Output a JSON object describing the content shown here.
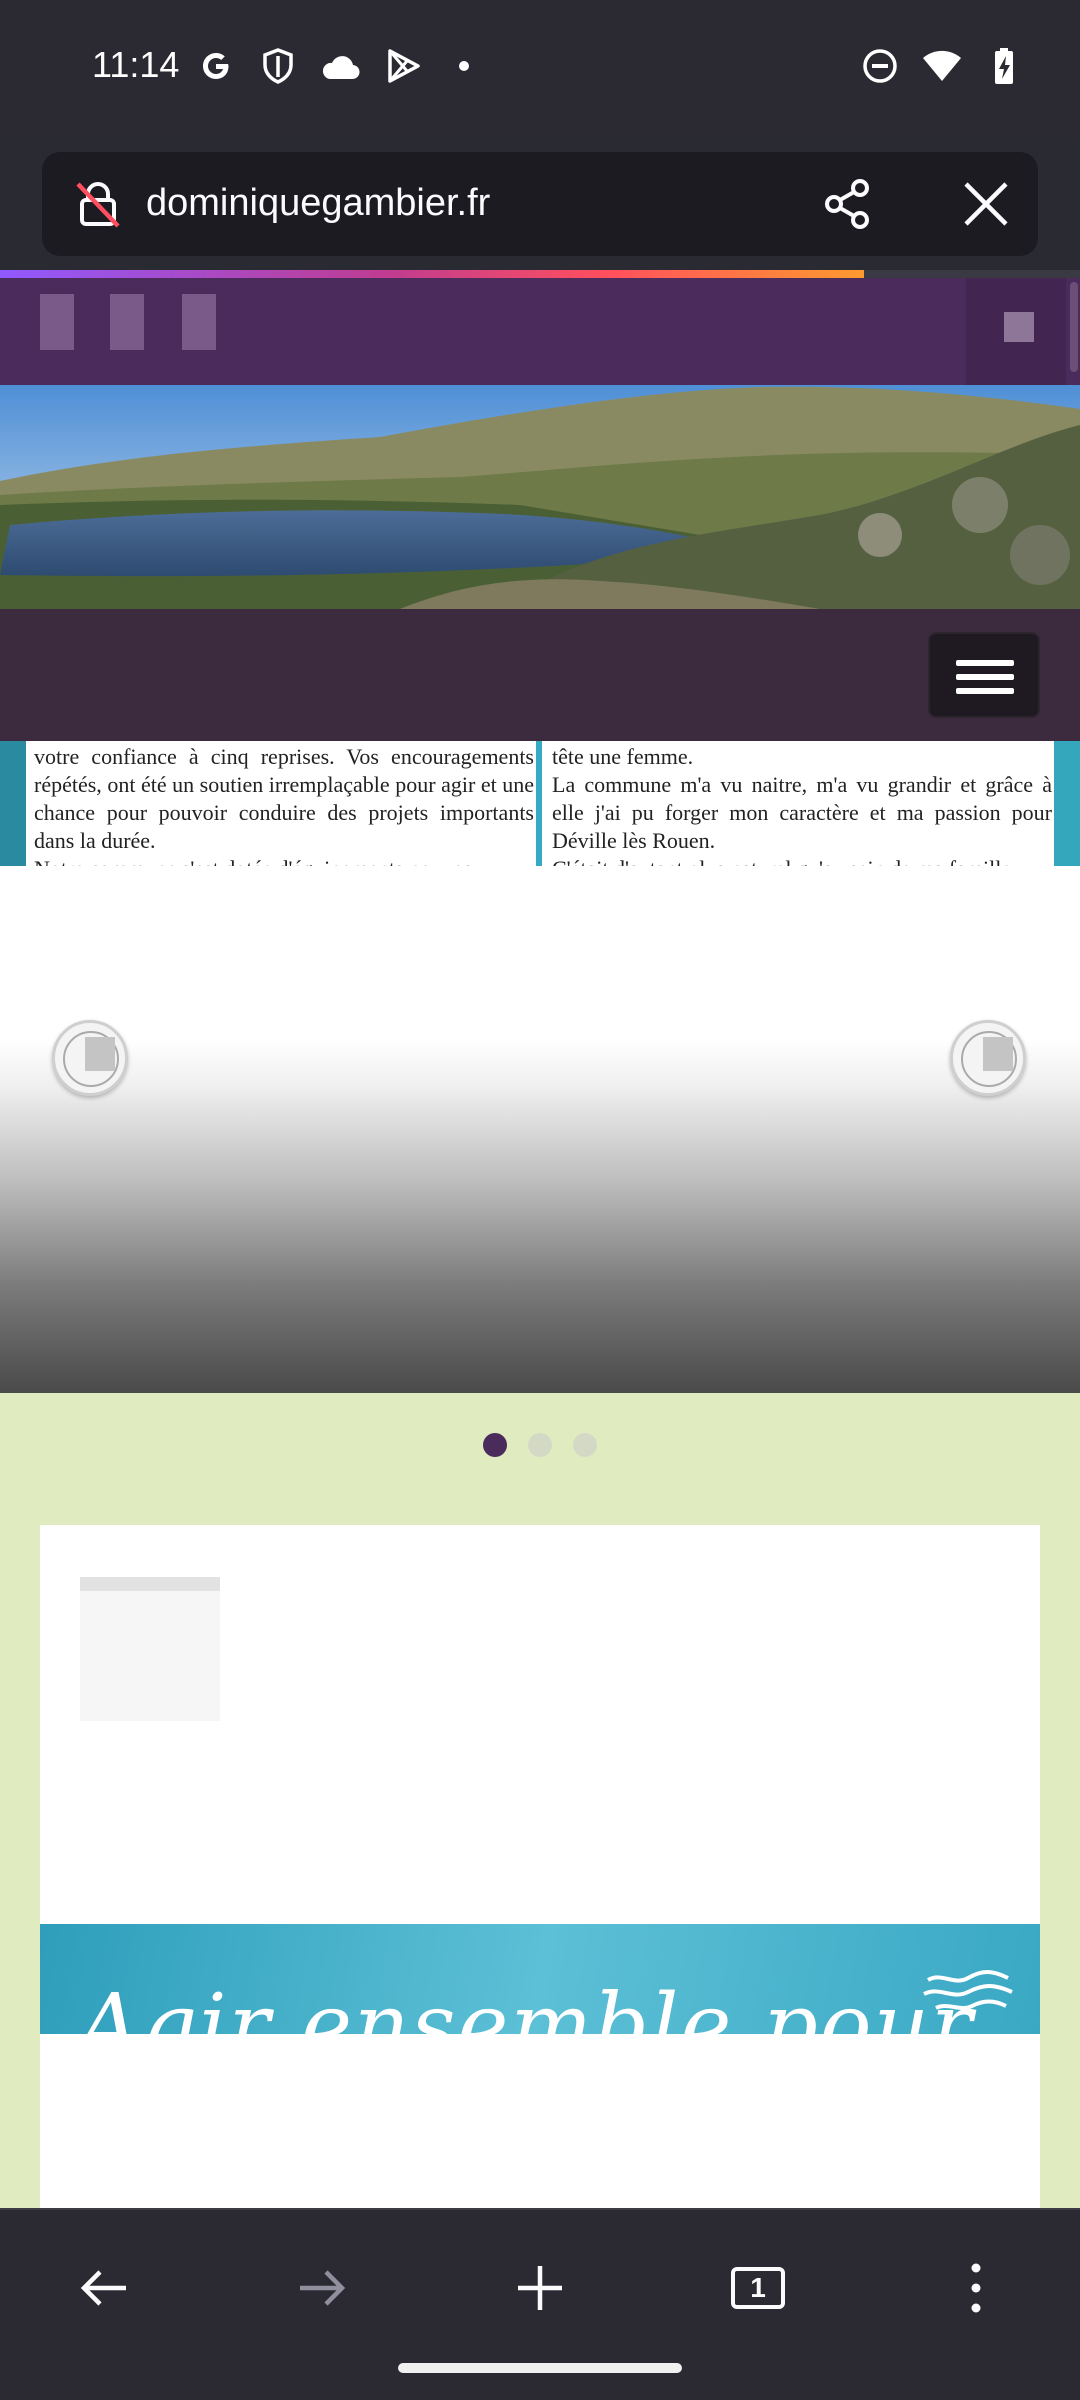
{
  "status_bar": {
    "time": "11:14",
    "left_icons": [
      "google-icon",
      "shield-icon",
      "cloud-icon",
      "play-store-icon",
      "dot-icon"
    ],
    "right_icons": [
      "do-not-disturb-icon",
      "wifi-icon",
      "battery-charging-icon"
    ]
  },
  "browser": {
    "url": "dominiquegambier.fr",
    "lock_icon": "insecure-lock-icon",
    "share_icon": "share-icon",
    "close_icon": "close-icon",
    "progress": 0.8,
    "accent_colors": [
      "#9059ff",
      "#ff4f5e",
      "#ff9a2e"
    ]
  },
  "site": {
    "theme_color": "#4b2a5c",
    "background_color": "#e0ecc0",
    "menu_icon": "hamburger-menu-icon",
    "article": {
      "left_column": [
        "votre confiance à cinq reprises. Vos encouragements répétés, ont été un soutien irremplaçable pour agir et une chance pour pouvoir conduire des projets importants dans la durée.",
        "Notre commune s'est dotée d'équipements nouveaux"
      ],
      "right_column": [
        "tête une femme.",
        "La commune m'a vu naitre, m'a vu grandir et grâce à elle j'ai pu forger mon caractère et ma passion pour Déville lès Rouen.",
        "C'était d'autant plus naturel qu'au sein de ma famille"
      ]
    },
    "slider": {
      "prev_icon": "slider-prev-icon",
      "next_icon": "slider-next-icon",
      "pagination_count": 3,
      "active_index": 0
    },
    "card": {
      "banner_text": "Agir ensemble pour"
    }
  },
  "toolbar": {
    "back_icon": "back-arrow-icon",
    "forward_icon": "forward-arrow-icon",
    "new_tab_icon": "plus-icon",
    "tab_count": "1",
    "menu_icon": "more-vertical-icon"
  }
}
